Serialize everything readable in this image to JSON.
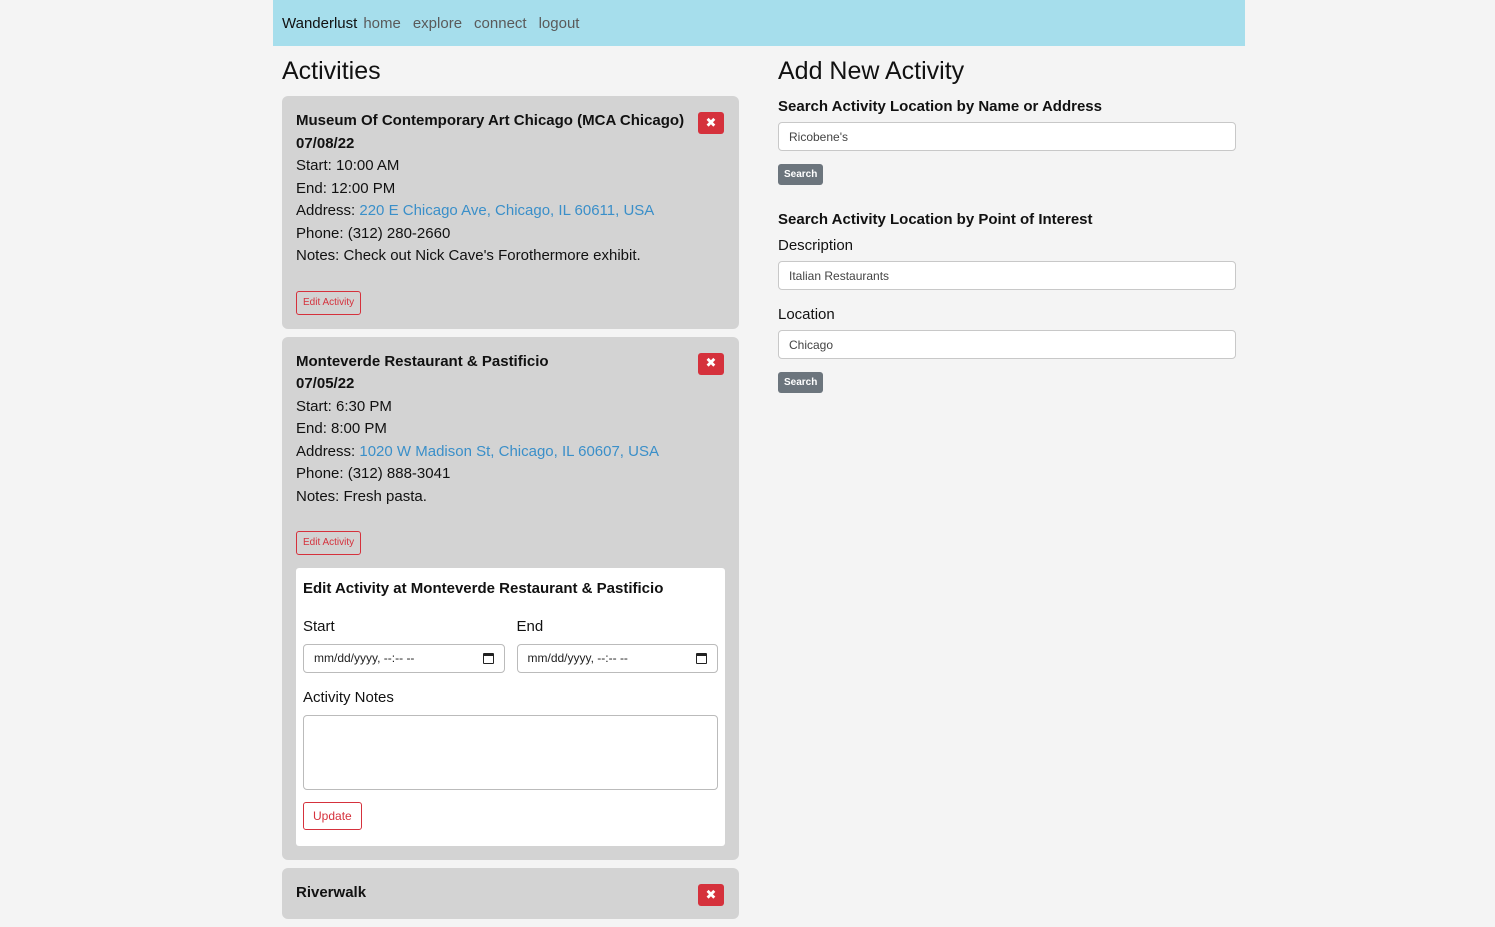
{
  "nav": {
    "brand": "Wanderlust",
    "links": [
      "home",
      "explore",
      "connect",
      "logout"
    ]
  },
  "left": {
    "title": "Activities",
    "delete_glyph": "✖",
    "activities": [
      {
        "name": "Museum Of Contemporary Art Chicago (MCA Chicago)",
        "date": "07/08/22",
        "start": "Start: 10:00 AM",
        "end": "End: 12:00 PM",
        "address_label": "Address: ",
        "address": "220 E Chicago Ave, Chicago, IL 60611, USA",
        "phone": "Phone: (312) 280-2660",
        "notes": "Notes: Check out Nick Cave's Forothermore exhibit.",
        "edit_label": "Edit Activity"
      },
      {
        "name": "Monteverde Restaurant & Pastificio",
        "date": "07/05/22",
        "start": "Start: 6:30 PM",
        "end": "End: 8:00 PM",
        "address_label": "Address: ",
        "address": "1020 W Madison St, Chicago, IL 60607, USA",
        "phone": "Phone: (312) 888-3041",
        "notes": "Notes: Fresh pasta.",
        "edit_label": "Edit Activity"
      },
      {
        "name": "Riverwalk"
      }
    ],
    "edit_panel": {
      "title": "Edit Activity at Monteverde Restaurant & Pastificio",
      "start_label": "Start",
      "end_label": "End",
      "start_value": "mm/dd/yyyy, --:-- --",
      "end_value": "mm/dd/yyyy, --:-- --",
      "notes_label": "Activity Notes",
      "notes_value": "",
      "update_label": "Update"
    }
  },
  "right": {
    "title": "Add New Activity",
    "by_name_label": "Search Activity Location by Name or Address",
    "by_name_value": "Ricobene's",
    "search_label": "Search",
    "by_poi_label": "Search Activity Location by Point of Interest",
    "description_label": "Description",
    "description_value": "Italian Restaurants",
    "location_label": "Location",
    "location_value": "Chicago",
    "search2_label": "Search"
  }
}
